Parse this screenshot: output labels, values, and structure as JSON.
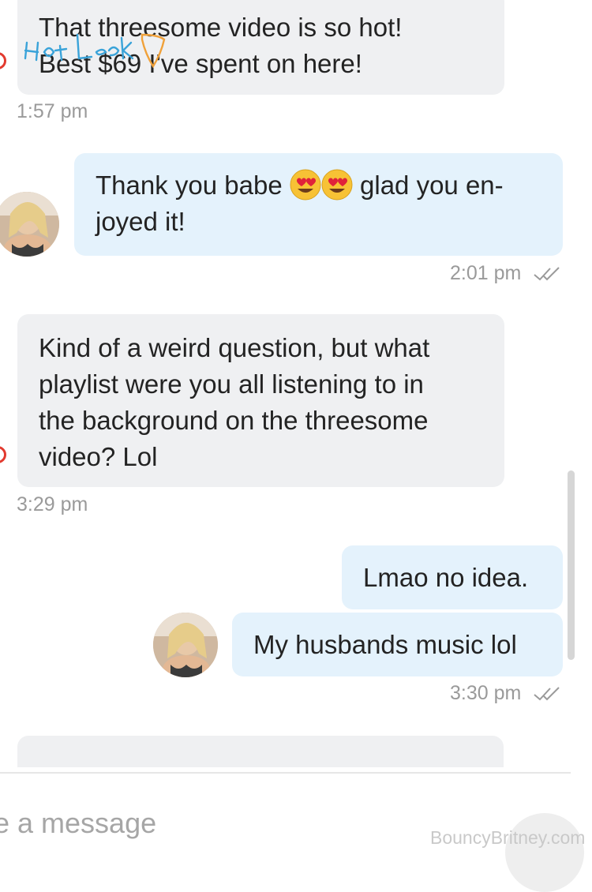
{
  "messages": [
    {
      "id": "m1",
      "direction": "incoming",
      "lines": [
        "That threesome video is so hot!",
        "Best $69 I've spent on here!"
      ],
      "time": "1:57 pm"
    },
    {
      "id": "m2",
      "direction": "outgoing",
      "text_a": "Thank you babe",
      "text_b": "glad you en-",
      "text_c": "joyed it!",
      "emojis": [
        "heart-eyes-emoji",
        "heart-eyes-emoji"
      ],
      "time": "2:01 pm",
      "status": "read"
    },
    {
      "id": "m3",
      "direction": "incoming",
      "lines": [
        "Kind of a weird question, but what",
        "playlist were you all listening to in",
        "the background on the threesome",
        "video? Lol"
      ],
      "time": "3:29 pm"
    },
    {
      "id": "m4",
      "direction": "outgoing",
      "text": "Lmao no idea."
    },
    {
      "id": "m5",
      "direction": "outgoing",
      "text": "My husbands music lol",
      "time": "3:30 pm",
      "status": "read"
    }
  ],
  "composer": {
    "placeholder_visible": "e a message"
  },
  "watermarks": {
    "logo_text": "Hot Leak",
    "site": "BouncyBritney.com"
  },
  "colors": {
    "incoming_bubble": "#eff0f2",
    "outgoing_bubble": "#e4f2fc",
    "timestamp": "#9a9a9a",
    "read_check": "#9a9a9a"
  }
}
